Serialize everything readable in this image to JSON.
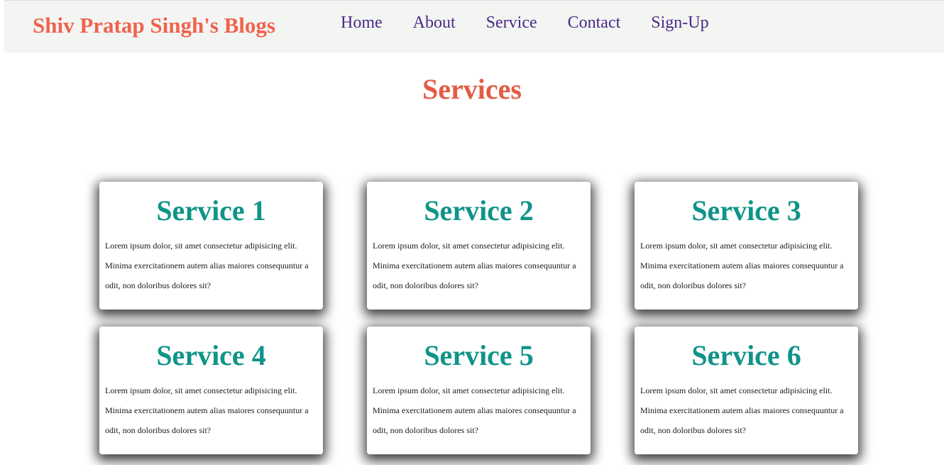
{
  "navbar": {
    "brand": "Shiv Pratap Singh's Blogs",
    "links": [
      "Home",
      "About",
      "Service",
      "Contact",
      "Sign-Up"
    ]
  },
  "main": {
    "title": "Services",
    "cards": [
      {
        "title": "Service 1",
        "text": "Lorem ipsum dolor, sit amet consectetur adipisicing elit. Minima exercitationem autem alias maiores consequuntur a odit, non doloribus dolores sit?"
      },
      {
        "title": "Service 2",
        "text": "Lorem ipsum dolor, sit amet consectetur adipisicing elit. Minima exercitationem autem alias maiores consequuntur a odit, non doloribus dolores sit?"
      },
      {
        "title": "Service 3",
        "text": "Lorem ipsum dolor, sit amet consectetur adipisicing elit. Minima exercitationem autem alias maiores consequuntur a odit, non doloribus dolores sit?"
      },
      {
        "title": "Service 4",
        "text": "Lorem ipsum dolor, sit amet consectetur adipisicing elit. Minima exercitationem autem alias maiores consequuntur a odit, non doloribus dolores sit?"
      },
      {
        "title": "Service 5",
        "text": "Lorem ipsum dolor, sit amet consectetur adipisicing elit. Minima exercitationem autem alias maiores consequuntur a odit, non doloribus dolores sit?"
      },
      {
        "title": "Service 6",
        "text": "Lorem ipsum dolor, sit amet consectetur adipisicing elit. Minima exercitationem autem alias maiores consequuntur a odit, non doloribus dolores sit?"
      }
    ]
  },
  "colors": {
    "brand": "#f0624d",
    "nav_link": "#4a2a8a",
    "page_title": "#e35b45",
    "card_title": "#0f9488",
    "navbar_bg": "#f3f5f2"
  }
}
